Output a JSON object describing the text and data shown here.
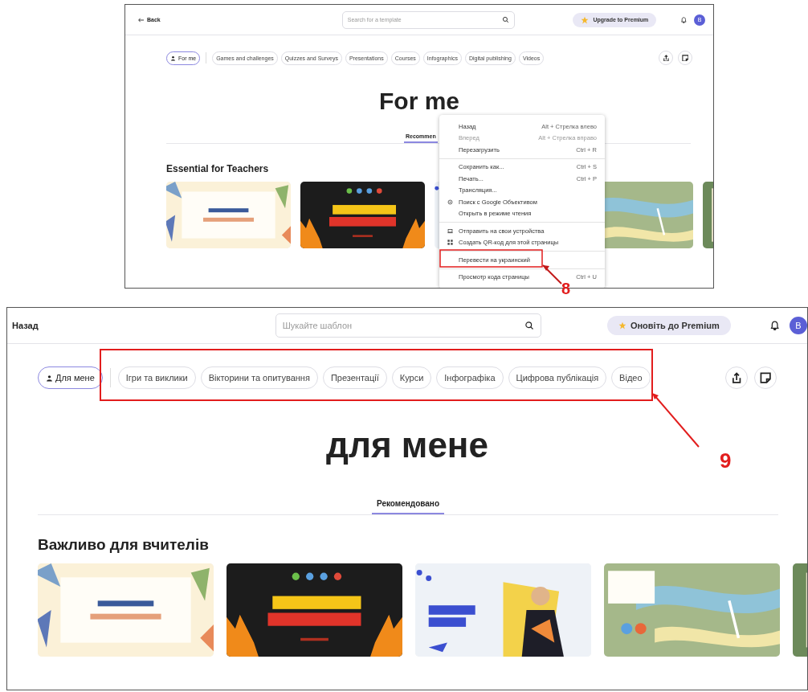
{
  "top_screenshot": {
    "header": {
      "back": "Back",
      "search_placeholder": "Search for a template",
      "upgrade": "Upgrade to Premium",
      "avatar": "B"
    },
    "chips": [
      {
        "label": "For me",
        "selected": true
      },
      {
        "label": "Games and challenges",
        "selected": false
      },
      {
        "label": "Quizzes and Surveys",
        "selected": false
      },
      {
        "label": "Presentations",
        "selected": false
      },
      {
        "label": "Courses",
        "selected": false
      },
      {
        "label": "Infographics",
        "selected": false
      },
      {
        "label": "Digital publishing",
        "selected": false
      },
      {
        "label": "Videos",
        "selected": false
      }
    ],
    "heading": "For me",
    "tabs": [
      {
        "label": "Recommen",
        "selected": true
      }
    ],
    "section_title": "Essential for Teachers",
    "context_menu": {
      "groups": [
        [
          {
            "label": "Назад",
            "shortcut": "Alt + Стрелка влево",
            "disabled": false,
            "kind": "plain"
          },
          {
            "label": "Вперед",
            "shortcut": "Alt + Стрелка вправо",
            "disabled": true,
            "kind": "plain"
          },
          {
            "label": "Перезагрузить",
            "shortcut": "Ctrl + R",
            "disabled": false,
            "kind": "plain"
          }
        ],
        [
          {
            "label": "Сохранить как...",
            "shortcut": "Ctrl + S",
            "disabled": false,
            "kind": "plain"
          },
          {
            "label": "Печать...",
            "shortcut": "Ctrl + P",
            "disabled": false,
            "kind": "plain"
          },
          {
            "label": "Трансляция...",
            "disabled": false,
            "kind": "plain"
          },
          {
            "label": "Поиск с Google Объективом",
            "disabled": false,
            "kind": "lens"
          },
          {
            "label": "Открыть в режиме чтения",
            "disabled": false,
            "kind": "plain"
          }
        ],
        [
          {
            "label": "Отправить на свои устройства",
            "disabled": false,
            "kind": "device"
          },
          {
            "label": "Создать QR-код для этой страницы",
            "disabled": false,
            "kind": "qr"
          }
        ],
        [
          {
            "label": "Перевести на украинский",
            "disabled": false,
            "kind": "plain"
          }
        ],
        [
          {
            "label": "Просмотр кода страницы",
            "shortcut": "Ctrl + U",
            "disabled": false,
            "kind": "plain"
          }
        ]
      ]
    },
    "annotation": {
      "label": "8"
    }
  },
  "bottom_screenshot": {
    "header": {
      "back": "Назад",
      "search_placeholder": "Шукайте шаблон",
      "upgrade": "Оновіть до Premium",
      "avatar": "B"
    },
    "chips": [
      {
        "label": "Для мене",
        "selected": true
      },
      {
        "label": "Ігри та виклики",
        "selected": false
      },
      {
        "label": "Вікторини та опитування",
        "selected": false
      },
      {
        "label": "Презентації",
        "selected": false
      },
      {
        "label": "Курси",
        "selected": false
      },
      {
        "label": "Інфографіка",
        "selected": false
      },
      {
        "label": "Цифрова публікація",
        "selected": false
      },
      {
        "label": "Відео",
        "selected": false
      }
    ],
    "heading": "для мене",
    "tabs": [
      {
        "label": "Рекомендовано",
        "selected": true
      }
    ],
    "section_title": "Важливо для вчителів",
    "annotation": {
      "label": "9"
    }
  }
}
